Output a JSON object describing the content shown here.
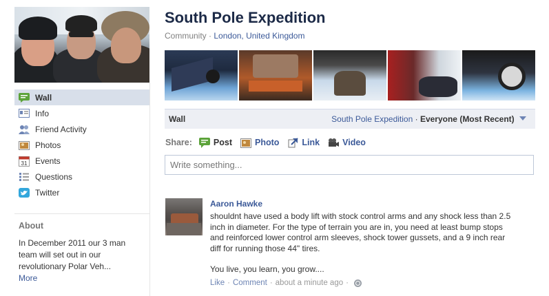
{
  "page": {
    "title": "South Pole Expedition",
    "category": "Community",
    "location": "London, United Kingdom"
  },
  "nav": {
    "items": [
      {
        "label": "Wall",
        "icon": "wall-speech-icon",
        "active": true
      },
      {
        "label": "Info",
        "icon": "info-card-icon"
      },
      {
        "label": "Friend Activity",
        "icon": "friends-icon"
      },
      {
        "label": "Photos",
        "icon": "photos-icon"
      },
      {
        "label": "Events",
        "icon": "calendar-icon",
        "icon_text": "31"
      },
      {
        "label": "Questions",
        "icon": "questions-icon"
      },
      {
        "label": "Twitter",
        "icon": "twitter-bird-icon"
      }
    ]
  },
  "about": {
    "title": "About",
    "text": "In December 2011 our 3 man team will set out in our revolutionary Polar Veh...",
    "more": "More"
  },
  "wall": {
    "title": "Wall",
    "filter_page": "South Pole Expedition",
    "filter_mode": "Everyone (Most Recent)"
  },
  "share": {
    "label": "Share:",
    "options": [
      {
        "label": "Post",
        "icon": "post-speech-icon"
      },
      {
        "label": "Photo",
        "icon": "photo-icon"
      },
      {
        "label": "Link",
        "icon": "link-icon"
      },
      {
        "label": "Video",
        "icon": "video-camera-icon"
      }
    ],
    "placeholder": "Write something..."
  },
  "post": {
    "author": "Aaron Hawke",
    "text1": "shouldnt have used a body lift with stock control arms and any shock less than 2.5 inch in diameter. For the type of terrain you are in, you need at least bump stops and reinforced lower control arm sleeves, shock tower gussets, and a 9 inch rear diff for running those 44\" tires.",
    "text2": "You live, you learn, you grow....",
    "actions": {
      "like": "Like",
      "comment": "Comment",
      "time": "about a minute ago"
    }
  },
  "colors": {
    "brand_blue": "#3b5998",
    "nav_active_bg": "#d8dfea",
    "bar_bg": "#edeff4"
  }
}
